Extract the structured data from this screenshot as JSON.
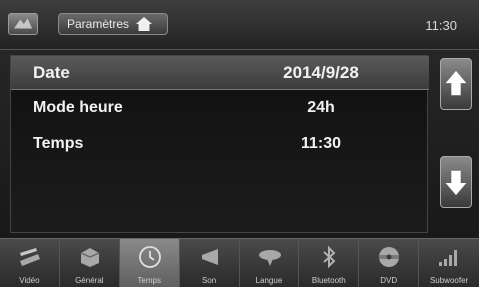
{
  "header": {
    "title": "Paramètres",
    "time": "11:30"
  },
  "settings": [
    {
      "label": "Date",
      "value": "2014/9/28"
    },
    {
      "label": "Mode heure",
      "value": "24h"
    },
    {
      "label": "Temps",
      "value": "11:30"
    }
  ],
  "tabs": [
    {
      "label": "Vidéo",
      "icon": "video-icon"
    },
    {
      "label": "Général",
      "icon": "general-icon"
    },
    {
      "label": "Temps",
      "icon": "clock-icon"
    },
    {
      "label": "Son",
      "icon": "speaker-icon"
    },
    {
      "label": "Langue",
      "icon": "language-icon"
    },
    {
      "label": "Bluetooth",
      "icon": "bluetooth-icon"
    },
    {
      "label": "DVD",
      "icon": "dvd-icon"
    },
    {
      "label": "Subwoofer",
      "icon": "subwoofer-icon"
    }
  ],
  "active_tab": "Temps"
}
